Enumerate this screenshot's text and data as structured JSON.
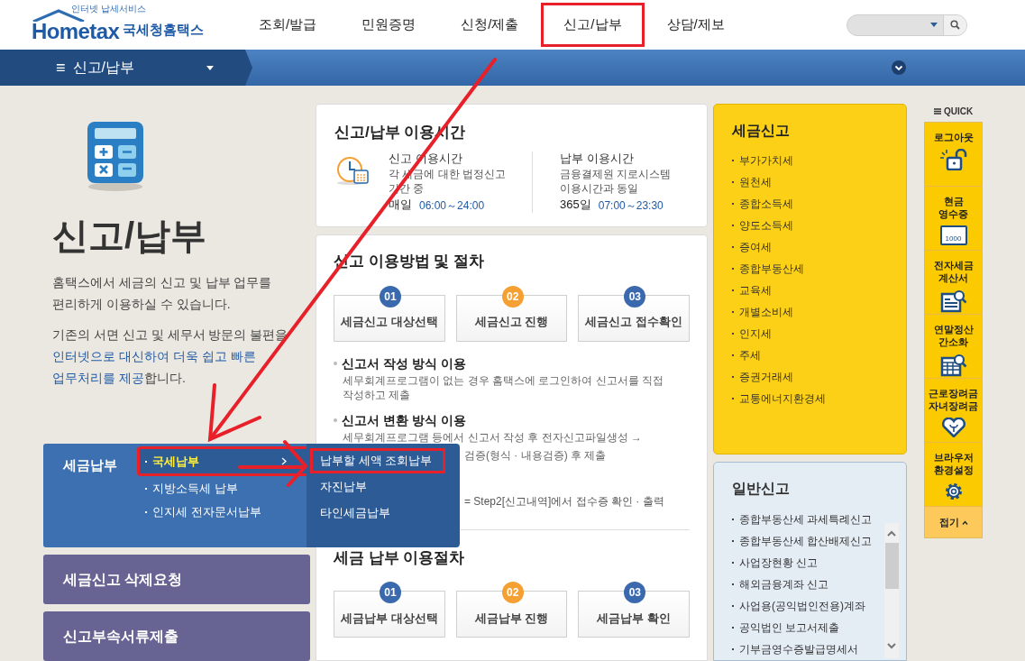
{
  "header": {
    "logo": {
      "tagline": "인터넷 납세서비스",
      "brand": "Hometax",
      "org": "국세청홈택스"
    },
    "nav": [
      {
        "label": "조회/발급",
        "highlighted": false
      },
      {
        "label": "민원증명",
        "highlighted": false
      },
      {
        "label": "신청/제출",
        "highlighted": false
      },
      {
        "label": "신고/납부",
        "highlighted": true
      },
      {
        "label": "상담/제보",
        "highlighted": false
      }
    ]
  },
  "breadcrumb": {
    "menu_icon": "≡",
    "label": "신고/납부"
  },
  "intro": {
    "title": "신고/납부",
    "paragraphs": [
      [
        {
          "text": "홈택스에서 세금의 신고 및 납부 업무를",
          "emphasis": false
        },
        {
          "text": "편리하게 이용하실 수 있습니다.",
          "emphasis": false
        }
      ],
      [
        {
          "text": "기존의 서면 신고 및 세무서 방문의 불편을",
          "emphasis": false
        },
        {
          "text": "인터넷으로 대신하여 더욱 쉽고 빠른",
          "emphasis": true
        },
        {
          "text": "업무처리를 제공",
          "emphasis": true
        },
        {
          "text": "합니다.",
          "emphasis": false
        }
      ]
    ]
  },
  "side_menu": [
    {
      "label": "세금납부",
      "expanded": true,
      "items": [
        {
          "label": "국세납부",
          "selected": true,
          "highlighted": true,
          "children": [
            {
              "label": "납부할 세액 조회납부",
              "highlighted": true
            },
            {
              "label": "자진납부",
              "highlighted": false
            },
            {
              "label": "타인세금납부",
              "highlighted": false
            }
          ]
        },
        {
          "label": "지방소득세 납부",
          "selected": false,
          "highlighted": false
        },
        {
          "label": "인지세 전자문서납부",
          "selected": false,
          "highlighted": false
        }
      ]
    },
    {
      "label": "세금신고 삭제요청",
      "expanded": false
    },
    {
      "label": "신고부속서류제출",
      "expanded": false
    }
  ],
  "hours": {
    "title": "신고/납부 이용시간",
    "columns": [
      {
        "heading": "신고 이용시간",
        "lines": [
          "각 세금에 대한 법정신고",
          "기간 중"
        ],
        "day": "매일",
        "time": "06:00～24:00"
      },
      {
        "heading": "납부 이용시간",
        "lines": [
          "금융결제원 지로시스템",
          "이용시간과 동일"
        ],
        "day": "365일",
        "time": "07:00～23:30"
      }
    ]
  },
  "filing_procedure": {
    "title": "신고 이용방법 및 절차",
    "steps": [
      {
        "number": "01",
        "label": "세금신고 대상선택",
        "color": "#3a69ad"
      },
      {
        "number": "02",
        "label": "세금신고 진행",
        "color": "#f5a033"
      },
      {
        "number": "03",
        "label": "세금신고 접수확인",
        "color": "#3a69ad"
      }
    ],
    "methods": [
      {
        "title": "신고서 작성 방식 이용",
        "lines": [
          "세무회계프로그램이 없는 경우 홈택스에 로그인하여 신고서를 직접",
          "작성하고 제출"
        ]
      },
      {
        "title": "신고서 변환 방식 이용",
        "lines": [
          "세무회계프로그램 등에서 신고서 작성 후 전자신고파일생성 →"
        ],
        "uncovered_tail": "검증(형식 · 내용검증) 후 제출"
      }
    ],
    "note": "= Step2[신고내역]에서 접수증 확인 · 출력"
  },
  "payment_procedure": {
    "title": "세금 납부 이용절차",
    "steps": [
      {
        "number": "01",
        "label": "세금납부 대상선택",
        "color": "#3a69ad"
      },
      {
        "number": "02",
        "label": "세금납부 진행",
        "color": "#f5a033"
      },
      {
        "number": "03",
        "label": "세금납부 확인",
        "color": "#3a69ad"
      }
    ]
  },
  "tax_filing": {
    "title": "세금신고",
    "items": [
      "부가가치세",
      "원천세",
      "종합소득세",
      "양도소득세",
      "증여세",
      "종합부동산세",
      "교육세",
      "개별소비세",
      "인지세",
      "주세",
      "증권거래세",
      "교통에너지환경세"
    ]
  },
  "general_filing": {
    "title": "일반신고",
    "items": [
      "종합부동산세 과세특례신고",
      "종합부동산세 합산배제신고",
      "사업장현황 신고",
      "해외금융계좌 신고",
      "사업용(공익법인전용)계좌",
      "공익법인 보고서제출",
      "기부금영수증발급명세서"
    ]
  },
  "quick": {
    "title": "QUICK",
    "items": [
      {
        "kind": "lock",
        "lines": [
          "로그아웃"
        ]
      },
      {
        "kind": "receipt",
        "lines": [
          "현금",
          "영수증"
        ],
        "icon_text": "1000"
      },
      {
        "kind": "invoice",
        "lines": [
          "전자세금",
          "계산서"
        ]
      },
      {
        "kind": "table",
        "lines": [
          "연말정산",
          "간소화"
        ]
      },
      {
        "kind": "heart",
        "lines": [
          "근로장려금",
          "자녀장려금"
        ]
      },
      {
        "kind": "gear",
        "lines": [
          "브라우저",
          "환경설정"
        ]
      }
    ],
    "collapse": "접기"
  }
}
